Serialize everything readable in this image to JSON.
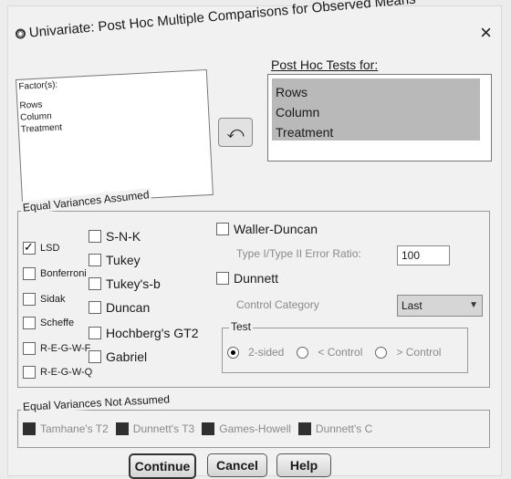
{
  "dialog": {
    "title": "Univariate: Post Hoc Multiple Comparisons for Observed Means",
    "close": "×"
  },
  "factors": {
    "legend": "Factor(s):",
    "items": [
      "Rows",
      "Column",
      "Treatment"
    ]
  },
  "move_button": {
    "icon": "arrow-left-icon"
  },
  "post_hoc": {
    "label": "Post Hoc Tests for:",
    "items": [
      "Rows",
      "Column",
      "Treatment"
    ]
  },
  "equal_variances": {
    "label": "Equal Variances Assumed",
    "lsd": "LSD",
    "bonferroni": "Bonferroni",
    "sidak": "Sidak",
    "scheffe": "Scheffe",
    "regwf": "R-E-G-W-F",
    "regwq": "R-E-G-W-Q",
    "snk": "S-N-K",
    "tukey": "Tukey",
    "tukeysb": "Tukey's-b",
    "duncan": "Duncan",
    "hochberg": "Hochberg's GT2",
    "gabriel": "Gabriel",
    "waller": "Waller-Duncan",
    "error_ratio_label": "Type I/Type II Error Ratio:",
    "error_ratio_value": "100",
    "dunnett": "Dunnett",
    "control_category_label": "Control Category",
    "control_category_value": "Last",
    "test_label": "Test",
    "two_sided": "2-sided",
    "less_control": "< Control",
    "greater_control": "> Control",
    "lsd_checked": true
  },
  "not_equal_variances": {
    "label": "Equal Variances Not Assumed",
    "tamhane": "Tamhane's T2",
    "dunnett_t3": "Dunnett's T3",
    "games_howell": "Games-Howell",
    "dunnett_c": "Dunnett's C"
  },
  "buttons": {
    "continue": "Continue",
    "cancel": "Cancel",
    "help": "Help"
  }
}
